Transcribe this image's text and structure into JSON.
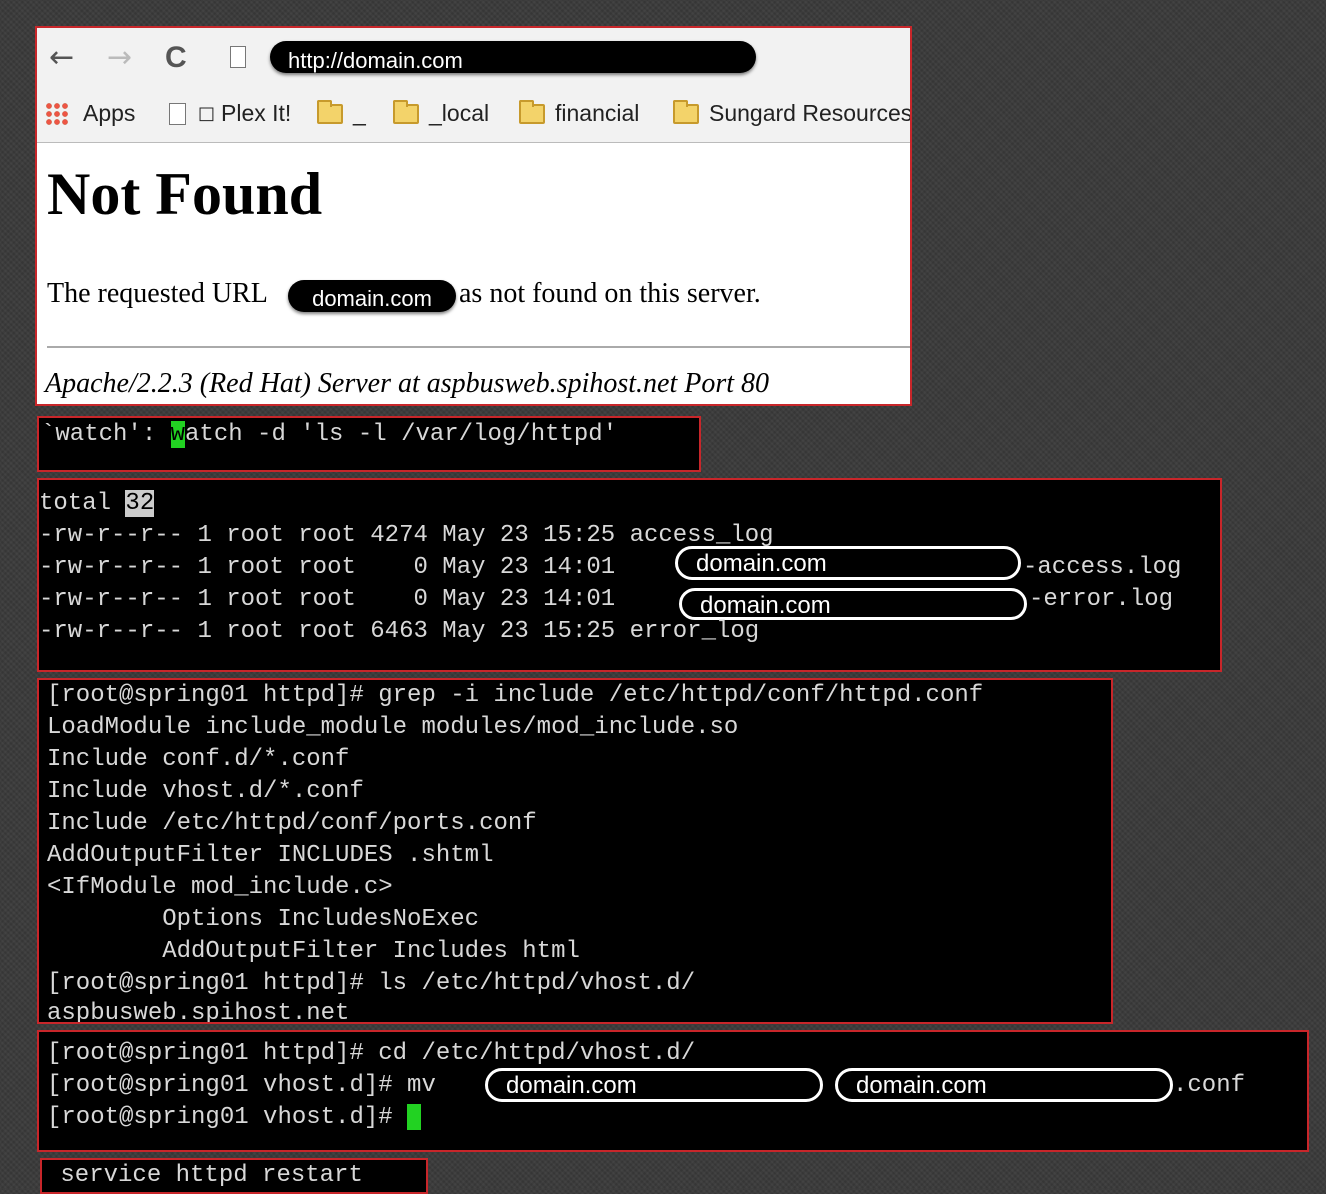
{
  "browser": {
    "nav": {
      "back": "←",
      "forward": "→",
      "reload": "C"
    },
    "url": "http://domain.com",
    "bookmarks": [
      {
        "label": "Apps"
      },
      {
        "label": "Plex It!"
      },
      {
        "label": "_"
      },
      {
        "label": "_local"
      },
      {
        "label": "financial"
      },
      {
        "label": "Sungard Resources"
      }
    ],
    "page": {
      "title": "Not Found",
      "message_prefix": "The requested URL",
      "message_url": "domain.com",
      "message_suffix": "as not found on this server.",
      "address": "Apache/2.2.3 (Red Hat) Server at aspbusweb.spihost.net Port 80"
    }
  },
  "watch": {
    "prefix": "`watch': ",
    "cursor_char": "w",
    "rest": "atch -d 'ls -l /var/log/httpd'"
  },
  "listing": {
    "total_label": "total",
    "total_value": "32",
    "rows": [
      {
        "perms": "-rw-r--r--",
        "links": "1",
        "owner": "root",
        "group": "root",
        "size": "4274",
        "month": "May",
        "day": "23",
        "time": "15:25",
        "name": "access_log"
      },
      {
        "perms": "-rw-r--r--",
        "links": "1",
        "owner": "root",
        "group": "root",
        "size": "0",
        "month": "May",
        "day": "23",
        "time": "14:01",
        "name": "domain.com",
        "suffix": "-access.log"
      },
      {
        "perms": "-rw-r--r--",
        "links": "1",
        "owner": "root",
        "group": "root",
        "size": "0",
        "month": "May",
        "day": "23",
        "time": "14:01",
        "name": "domain.com",
        "suffix": "-error.log"
      },
      {
        "perms": "-rw-r--r--",
        "links": "1",
        "owner": "root",
        "group": "root",
        "size": "6463",
        "month": "May",
        "day": "23",
        "time": "15:25",
        "name": "error_log"
      }
    ]
  },
  "grep": {
    "lines": [
      "[root@spring01 httpd]# grep -i include /etc/httpd/conf/httpd.conf",
      "LoadModule include_module modules/mod_include.so",
      "Include conf.d/*.conf",
      "Include vhost.d/*.conf",
      "Include /etc/httpd/conf/ports.conf",
      "AddOutputFilter INCLUDES .shtml",
      "<IfModule mod_include.c>",
      "        Options IncludesNoExec",
      "        AddOutputFilter Includes html",
      "[root@spring01 httpd]# ls /etc/httpd/vhost.d/",
      "aspbusweb.spihost.net"
    ]
  },
  "mv": {
    "line1": "[root@spring01 httpd]# cd /etc/httpd/vhost.d/",
    "line2_prefix": "[root@spring01 vhost.d]# mv",
    "src": "domain.com",
    "dst": "domain.com",
    "dst_suffix": ".conf",
    "line3_prompt": "[root@spring01 vhost.d]#"
  },
  "restart": {
    "command": " service httpd restart"
  }
}
